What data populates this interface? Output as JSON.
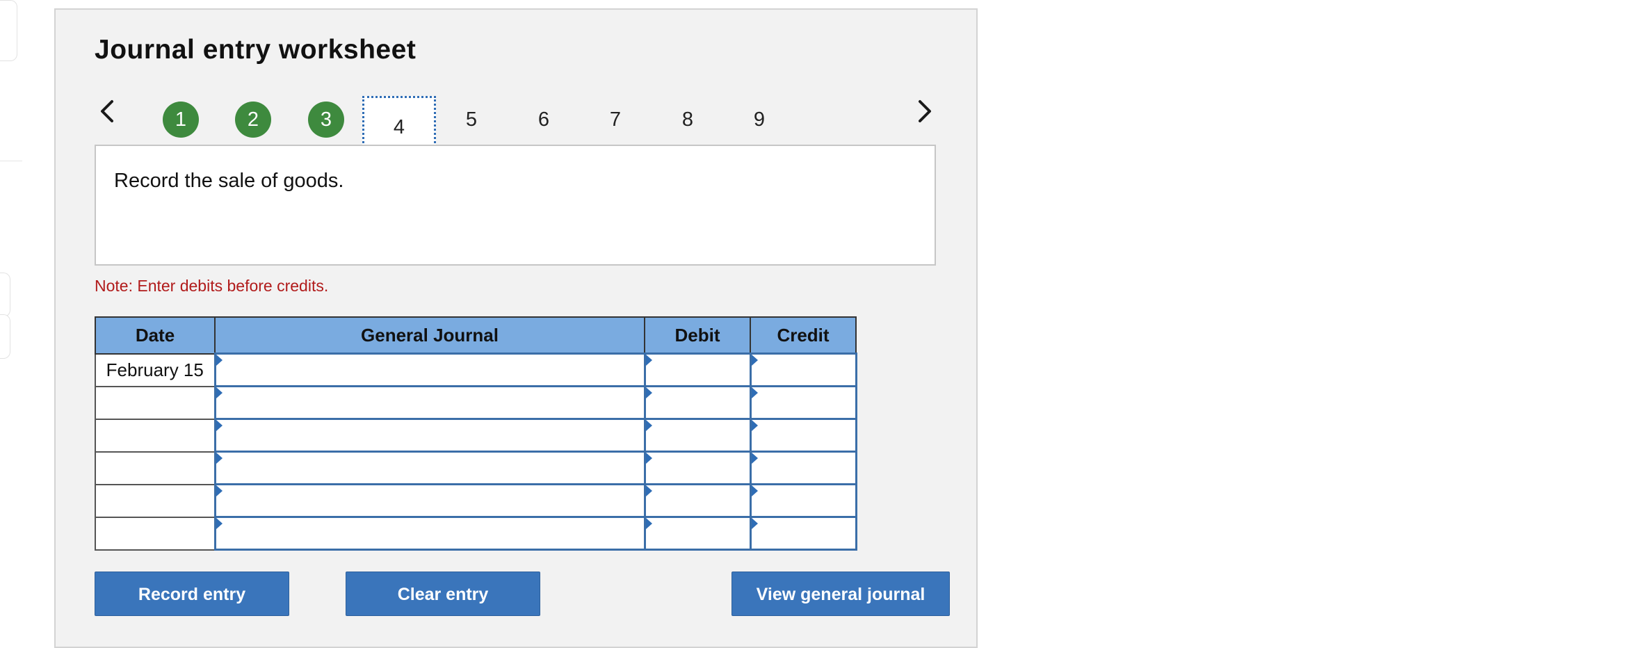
{
  "worksheet": {
    "title": "Journal entry worksheet",
    "steps": [
      "1",
      "2",
      "3",
      "4",
      "5",
      "6",
      "7",
      "8",
      "9"
    ],
    "completed_steps": [
      "1",
      "2",
      "3"
    ],
    "current_step": "4",
    "prompt": "Record the sale of goods.",
    "note": "Note: Enter debits before credits."
  },
  "table": {
    "headers": {
      "date": "Date",
      "journal": "General Journal",
      "debit": "Debit",
      "credit": "Credit"
    },
    "rows": [
      {
        "date": "February 15",
        "account": "",
        "debit": "",
        "credit": ""
      },
      {
        "date": "",
        "account": "",
        "debit": "",
        "credit": ""
      },
      {
        "date": "",
        "account": "",
        "debit": "",
        "credit": ""
      },
      {
        "date": "",
        "account": "",
        "debit": "",
        "credit": ""
      },
      {
        "date": "",
        "account": "",
        "debit": "",
        "credit": ""
      },
      {
        "date": "",
        "account": "",
        "debit": "",
        "credit": ""
      }
    ]
  },
  "buttons": {
    "record": "Record entry",
    "clear": "Clear entry",
    "view": "View general journal"
  },
  "icons": {
    "prev": "chevron-left-icon",
    "next": "chevron-right-icon"
  },
  "colors": {
    "completed_step": "#3e8a3e",
    "header_fill": "#7aabe0",
    "button": "#3a75bb",
    "note": "#b11b1b",
    "input_border": "#3b6ea8"
  }
}
